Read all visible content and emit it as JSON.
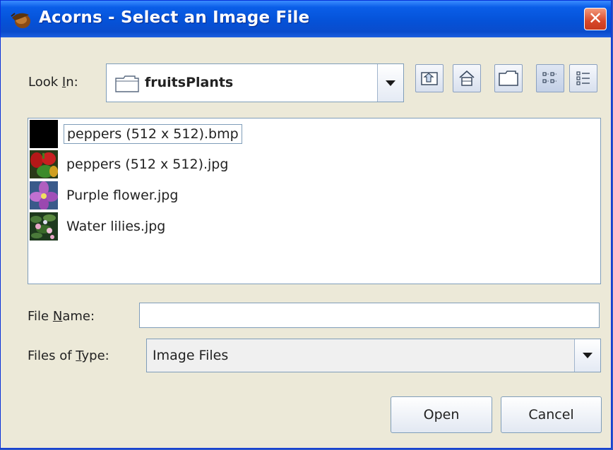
{
  "window": {
    "title": "Acorns - Select an Image File"
  },
  "look_in": {
    "label_prefix": "Look ",
    "label_accel": "I",
    "label_suffix": "n:",
    "value": "fruitsPlants"
  },
  "toolbar": {
    "icons": [
      "up-folder-icon",
      "home-icon",
      "new-folder-icon",
      "list-view-icon",
      "details-view-icon"
    ]
  },
  "files": [
    {
      "name": "peppers (512 x 512).bmp",
      "thumb": "black-thumbnail",
      "selected": true
    },
    {
      "name": "peppers (512 x 512).jpg",
      "thumb": "peppers-thumbnail",
      "selected": false
    },
    {
      "name": "Purple flower.jpg",
      "thumb": "purple-flower-thumbnail",
      "selected": false
    },
    {
      "name": "Water lilies.jpg",
      "thumb": "water-lilies-thumbnail",
      "selected": false
    }
  ],
  "file_name": {
    "label_prefix": "File ",
    "label_accel": "N",
    "label_suffix": "ame:",
    "value": ""
  },
  "file_type": {
    "label_prefix": "Files of ",
    "label_accel": "T",
    "label_suffix": "ype:",
    "value": "Image Files"
  },
  "buttons": {
    "open": "Open",
    "cancel": "Cancel"
  },
  "colors": {
    "titlebar": "#0552d8",
    "window_bg": "#ece9d8",
    "close": "#d8482a"
  }
}
